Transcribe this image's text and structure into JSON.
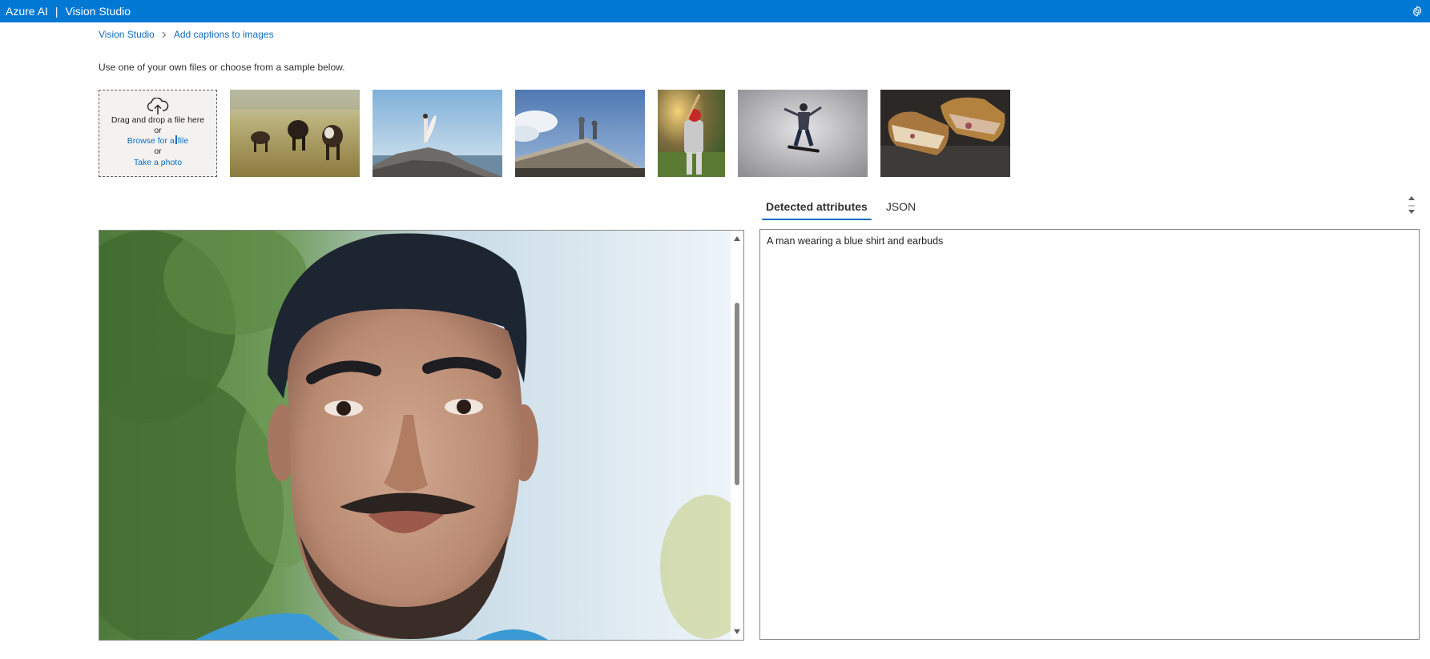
{
  "topbar": {
    "brand_left": "Azure AI",
    "separator": "|",
    "brand_right": "Vision Studio",
    "settings_icon": "gear-icon",
    "color": "#0078d4"
  },
  "breadcrumb": {
    "items": [
      "Vision Studio",
      "Add captions to images"
    ],
    "separator_icon": "chevron-right-icon"
  },
  "intro": "Use one of your own files or choose from a sample below.",
  "upload": {
    "icon": "cloud-upload-icon",
    "drag_text": "Drag and drop a file here",
    "or_1": "or",
    "browse_before": "Browse for a",
    "browse_after": "file",
    "or_2": "or",
    "take_photo": "Take a photo"
  },
  "samples": [
    {
      "name": "cows-in-field"
    },
    {
      "name": "surfer-on-rock"
    },
    {
      "name": "building-statue"
    },
    {
      "name": "baseball-batter"
    },
    {
      "name": "skateboarder"
    },
    {
      "name": "grilled-sandwich"
    }
  ],
  "tabs": [
    {
      "label": "Detected attributes",
      "active": true
    },
    {
      "label": "JSON",
      "active": false
    }
  ],
  "result": {
    "caption": "A man wearing a blue shirt and earbuds"
  },
  "colors": {
    "accent": "#0f6cbd",
    "border": "#8a8886"
  }
}
